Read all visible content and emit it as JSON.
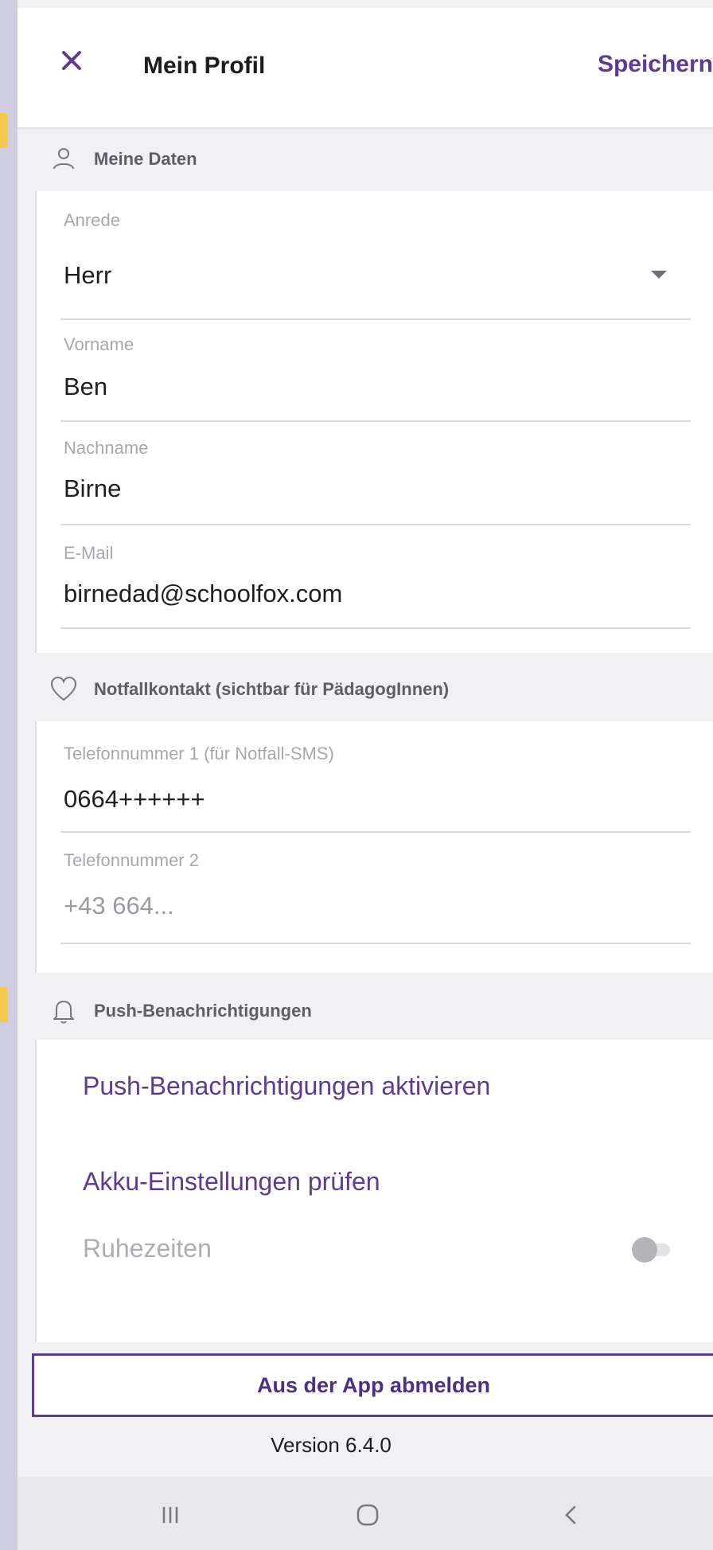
{
  "header": {
    "title": "Mein Profil",
    "save_label": "Speichern"
  },
  "sections": {
    "personal": {
      "title": "Meine Daten",
      "icon": "person-icon"
    },
    "emergency": {
      "title": "Notfallkontakt (sichtbar für PädagogInnen)",
      "icon": "heart-icon"
    },
    "push": {
      "title": "Push-Benachrichtigungen",
      "icon": "bell-icon"
    }
  },
  "personal": {
    "salutation": {
      "label": "Anrede",
      "value": "Herr"
    },
    "first_name": {
      "label": "Vorname",
      "value": "Ben"
    },
    "last_name": {
      "label": "Nachname",
      "value": "Birne"
    },
    "email": {
      "label": "E-Mail",
      "value": "birnedad@schoolfox.com"
    }
  },
  "emergency": {
    "phone1": {
      "label": "Telefonnummer 1 (für Notfall-SMS)",
      "value": "0664++++++"
    },
    "phone2": {
      "label": "Telefonnummer 2",
      "placeholder": "+43 664..."
    }
  },
  "push": {
    "enable_label": "Push-Benachrichtigungen aktivieren",
    "battery_label": "Akku-Einstellungen prüfen",
    "quiet_hours_label": "Ruhezeiten",
    "quiet_hours_enabled": false
  },
  "footer": {
    "logout_label": "Aus der App abmelden",
    "version": "Version 6.4.0"
  },
  "colors": {
    "accent": "#5d3b91",
    "background": "#f1f1f3",
    "marker": "#f4c84a"
  },
  "navbar": {
    "icons": [
      "recent-apps-icon",
      "home-icon",
      "back-icon"
    ]
  }
}
